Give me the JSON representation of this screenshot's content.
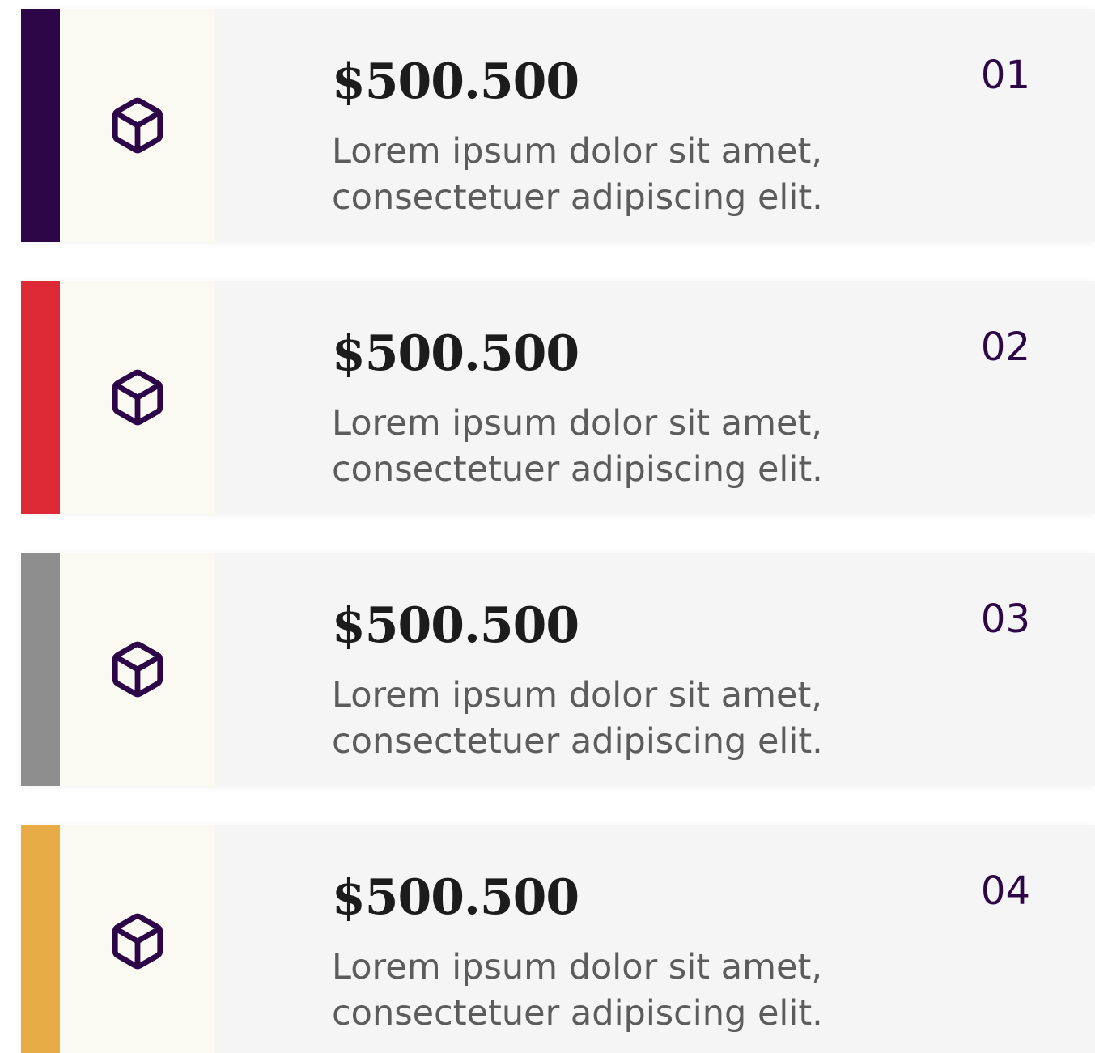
{
  "colors": {
    "icon": "#2d0648",
    "number": "#2d0648",
    "card_background": "#f5f5f5",
    "icon_panel_background": "#fafaf3"
  },
  "items": [
    {
      "amount": "$500.500",
      "description_line1": "Lorem ipsum dolor sit amet,",
      "description_line2": "consectetuer adipiscing elit.",
      "number": "01",
      "accent_color": "#2d0648",
      "icon": "cube-icon"
    },
    {
      "amount": "$500.500",
      "description_line1": "Lorem ipsum dolor sit amet,",
      "description_line2": "consectetuer adipiscing elit.",
      "number": "02",
      "accent_color": "#dd2a36",
      "icon": "cube-icon"
    },
    {
      "amount": "$500.500",
      "description_line1": "Lorem ipsum dolor sit amet,",
      "description_line2": "consectetuer adipiscing elit.",
      "number": "03",
      "accent_color": "#8e8e8e",
      "icon": "cube-icon"
    },
    {
      "amount": "$500.500",
      "description_line1": "Lorem ipsum dolor sit amet,",
      "description_line2": "consectetuer adipiscing elit.",
      "number": "04",
      "accent_color": "#e8ac46",
      "icon": "cube-icon"
    }
  ]
}
